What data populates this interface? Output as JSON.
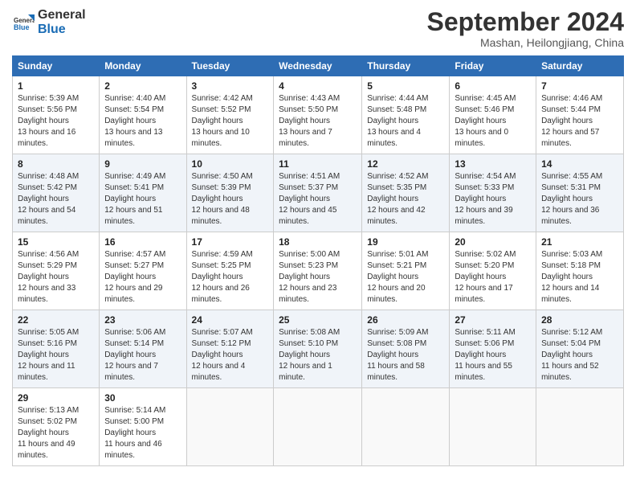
{
  "header": {
    "logo_line1": "General",
    "logo_line2": "Blue",
    "month": "September 2024",
    "location": "Mashan, Heilongjiang, China"
  },
  "columns": [
    "Sunday",
    "Monday",
    "Tuesday",
    "Wednesday",
    "Thursday",
    "Friday",
    "Saturday"
  ],
  "weeks": [
    [
      {
        "day": "1",
        "sunrise": "5:39 AM",
        "sunset": "5:56 PM",
        "daylight": "13 hours and 16 minutes."
      },
      {
        "day": "2",
        "sunrise": "4:40 AM",
        "sunset": "5:54 PM",
        "daylight": "13 hours and 13 minutes."
      },
      {
        "day": "3",
        "sunrise": "4:42 AM",
        "sunset": "5:52 PM",
        "daylight": "13 hours and 10 minutes."
      },
      {
        "day": "4",
        "sunrise": "4:43 AM",
        "sunset": "5:50 PM",
        "daylight": "13 hours and 7 minutes."
      },
      {
        "day": "5",
        "sunrise": "4:44 AM",
        "sunset": "5:48 PM",
        "daylight": "13 hours and 4 minutes."
      },
      {
        "day": "6",
        "sunrise": "4:45 AM",
        "sunset": "5:46 PM",
        "daylight": "13 hours and 0 minutes."
      },
      {
        "day": "7",
        "sunrise": "4:46 AM",
        "sunset": "5:44 PM",
        "daylight": "12 hours and 57 minutes."
      }
    ],
    [
      {
        "day": "8",
        "sunrise": "4:48 AM",
        "sunset": "5:42 PM",
        "daylight": "12 hours and 54 minutes."
      },
      {
        "day": "9",
        "sunrise": "4:49 AM",
        "sunset": "5:41 PM",
        "daylight": "12 hours and 51 minutes."
      },
      {
        "day": "10",
        "sunrise": "4:50 AM",
        "sunset": "5:39 PM",
        "daylight": "12 hours and 48 minutes."
      },
      {
        "day": "11",
        "sunrise": "4:51 AM",
        "sunset": "5:37 PM",
        "daylight": "12 hours and 45 minutes."
      },
      {
        "day": "12",
        "sunrise": "4:52 AM",
        "sunset": "5:35 PM",
        "daylight": "12 hours and 42 minutes."
      },
      {
        "day": "13",
        "sunrise": "4:54 AM",
        "sunset": "5:33 PM",
        "daylight": "12 hours and 39 minutes."
      },
      {
        "day": "14",
        "sunrise": "4:55 AM",
        "sunset": "5:31 PM",
        "daylight": "12 hours and 36 minutes."
      }
    ],
    [
      {
        "day": "15",
        "sunrise": "4:56 AM",
        "sunset": "5:29 PM",
        "daylight": "12 hours and 33 minutes."
      },
      {
        "day": "16",
        "sunrise": "4:57 AM",
        "sunset": "5:27 PM",
        "daylight": "12 hours and 29 minutes."
      },
      {
        "day": "17",
        "sunrise": "4:59 AM",
        "sunset": "5:25 PM",
        "daylight": "12 hours and 26 minutes."
      },
      {
        "day": "18",
        "sunrise": "5:00 AM",
        "sunset": "5:23 PM",
        "daylight": "12 hours and 23 minutes."
      },
      {
        "day": "19",
        "sunrise": "5:01 AM",
        "sunset": "5:21 PM",
        "daylight": "12 hours and 20 minutes."
      },
      {
        "day": "20",
        "sunrise": "5:02 AM",
        "sunset": "5:20 PM",
        "daylight": "12 hours and 17 minutes."
      },
      {
        "day": "21",
        "sunrise": "5:03 AM",
        "sunset": "5:18 PM",
        "daylight": "12 hours and 14 minutes."
      }
    ],
    [
      {
        "day": "22",
        "sunrise": "5:05 AM",
        "sunset": "5:16 PM",
        "daylight": "12 hours and 11 minutes."
      },
      {
        "day": "23",
        "sunrise": "5:06 AM",
        "sunset": "5:14 PM",
        "daylight": "12 hours and 7 minutes."
      },
      {
        "day": "24",
        "sunrise": "5:07 AM",
        "sunset": "5:12 PM",
        "daylight": "12 hours and 4 minutes."
      },
      {
        "day": "25",
        "sunrise": "5:08 AM",
        "sunset": "5:10 PM",
        "daylight": "12 hours and 1 minute."
      },
      {
        "day": "26",
        "sunrise": "5:09 AM",
        "sunset": "5:08 PM",
        "daylight": "11 hours and 58 minutes."
      },
      {
        "day": "27",
        "sunrise": "5:11 AM",
        "sunset": "5:06 PM",
        "daylight": "11 hours and 55 minutes."
      },
      {
        "day": "28",
        "sunrise": "5:12 AM",
        "sunset": "5:04 PM",
        "daylight": "11 hours and 52 minutes."
      }
    ],
    [
      {
        "day": "29",
        "sunrise": "5:13 AM",
        "sunset": "5:02 PM",
        "daylight": "11 hours and 49 minutes."
      },
      {
        "day": "30",
        "sunrise": "5:14 AM",
        "sunset": "5:00 PM",
        "daylight": "11 hours and 46 minutes."
      },
      null,
      null,
      null,
      null,
      null
    ]
  ]
}
